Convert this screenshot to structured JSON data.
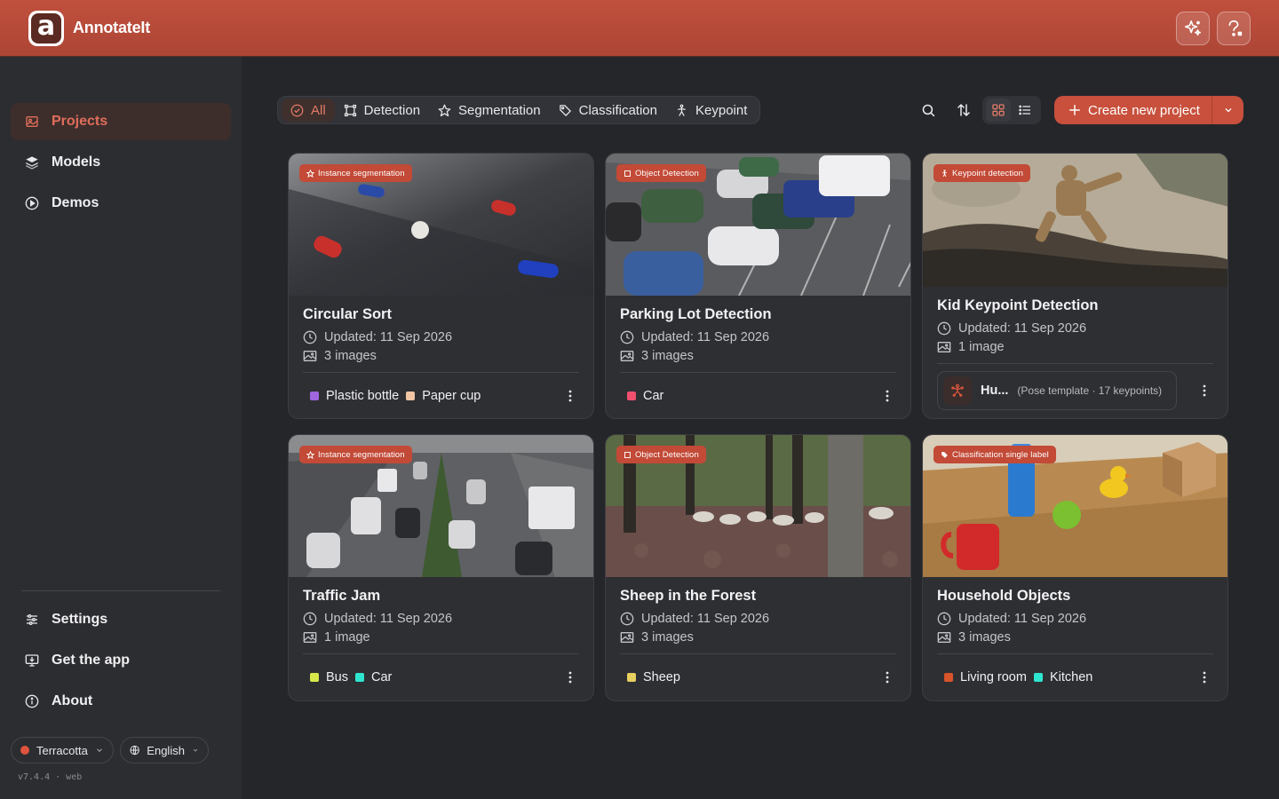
{
  "app": {
    "name": "AnnotateIt",
    "logo_letter": "a"
  },
  "sidebar": {
    "nav": [
      {
        "label": "Projects",
        "icon": "projects-icon",
        "active": true
      },
      {
        "label": "Models",
        "icon": "layers-icon",
        "active": false
      },
      {
        "label": "Demos",
        "icon": "play-circle-icon",
        "active": false
      }
    ],
    "bottom_nav": [
      {
        "label": "Settings",
        "icon": "sliders-icon"
      },
      {
        "label": "Get the app",
        "icon": "monitor-download-icon"
      },
      {
        "label": "About",
        "icon": "info-icon"
      }
    ],
    "theme": {
      "label": "Terracotta",
      "color": "#e0533f"
    },
    "language": {
      "label": "English"
    },
    "version": "v7.4.4 · web"
  },
  "filters": [
    {
      "label": "All",
      "icon": "check-circle-icon",
      "active": true
    },
    {
      "label": "Detection",
      "icon": "bbox-icon",
      "active": false
    },
    {
      "label": "Segmentation",
      "icon": "star-polygon-icon",
      "active": false
    },
    {
      "label": "Classification",
      "icon": "tag-icon",
      "active": false
    },
    {
      "label": "Keypoint",
      "icon": "person-keypoint-icon",
      "active": false
    }
  ],
  "toolbar": {
    "create_label": "Create new project"
  },
  "colors": {
    "accent": "#c8503c",
    "topbar": "#b84a39"
  },
  "projects": [
    {
      "title": "Circular Sort",
      "badge": "Instance segmentation",
      "updated": "Updated: 11 Sep 2026",
      "images": "3 images",
      "labels": [
        {
          "name": "Plastic bottle",
          "color": "#a066e0"
        },
        {
          "name": "Paper cup",
          "color": "#f2c6a4"
        }
      ]
    },
    {
      "title": "Parking Lot Detection",
      "badge": "Object Detection",
      "updated": "Updated: 11 Sep 2026",
      "images": "3 images",
      "labels": [
        {
          "name": "Car",
          "color": "#f0506e"
        }
      ]
    },
    {
      "title": "Kid Keypoint Detection",
      "badge": "Keypoint detection",
      "updated": "Updated: 11 Sep 2026",
      "images": "1 image",
      "pose": {
        "name": "Hu...",
        "desc": "(Pose template · 17 keypoints)"
      }
    },
    {
      "title": "Traffic Jam",
      "badge": "Instance segmentation",
      "updated": "Updated: 11 Sep 2026",
      "images": "1 image",
      "labels": [
        {
          "name": "Bus",
          "color": "#d8e84a"
        },
        {
          "name": "Car",
          "color": "#2ee6d0"
        }
      ]
    },
    {
      "title": "Sheep in the Forest",
      "badge": "Object Detection",
      "updated": "Updated: 11 Sep 2026",
      "images": "3 images",
      "labels": [
        {
          "name": "Sheep",
          "color": "#e8d060"
        }
      ]
    },
    {
      "title": "Household Objects",
      "badge": "Classification single label",
      "updated": "Updated: 11 Sep 2026",
      "images": "3 images",
      "labels": [
        {
          "name": "Living room",
          "color": "#d9532b"
        },
        {
          "name": "Kitchen",
          "color": "#2ee6d0"
        }
      ]
    }
  ]
}
